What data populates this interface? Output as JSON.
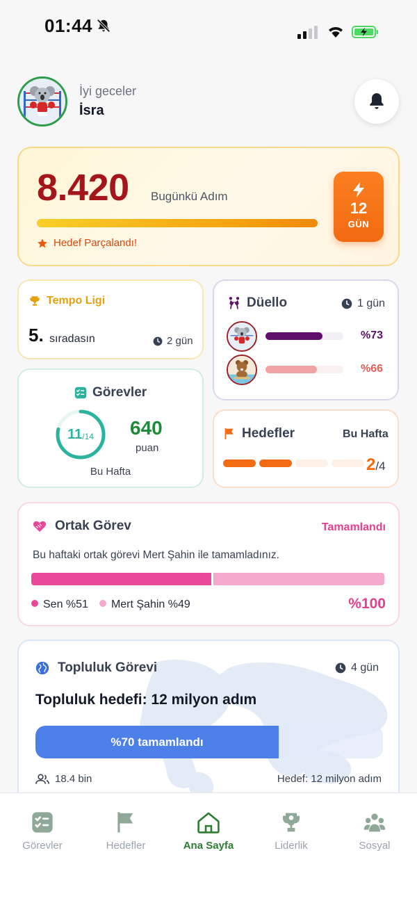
{
  "status_bar": {
    "time": "01:44"
  },
  "header": {
    "greeting": "İyi geceler",
    "user_name": "İsra"
  },
  "steps": {
    "value": "8.420",
    "label": "Bugünkü Adım",
    "progress": 1.0,
    "subtitle": "Hedef Parçalandı!",
    "streak_count": "12",
    "streak_unit": "GÜN"
  },
  "tempo": {
    "title": "Tempo Ligi",
    "rank": "5.",
    "rank_label": "sıradasın",
    "days": "2 gün"
  },
  "duel": {
    "title": "Düello",
    "days": "1 gün",
    "players": [
      {
        "percent_label": "%73",
        "progress": 0.73,
        "color": "#5e1168",
        "track": "#f1eef4"
      },
      {
        "percent_label": "%66",
        "progress": 0.66,
        "color": "#f0a3a3",
        "track": "#fbf0f0"
      }
    ]
  },
  "tasks": {
    "title": "Görevler",
    "done": "11",
    "total": "/14",
    "progress": 0.786,
    "points": "640",
    "points_label": "puan",
    "period": "Bu Hafta"
  },
  "goals": {
    "title": "Hedefler",
    "period": "Bu Hafta",
    "done": "2",
    "total": "/4",
    "completed": 2,
    "segments": 4
  },
  "shared_task": {
    "title": "Ortak Görev",
    "status": "Tamamlandı",
    "description": "Bu haftaki ortak görevi Mert Şahin ile tamamladınız.",
    "me_label": "Sen %51",
    "partner_label": "Mert Şahin %49",
    "me_share": 0.51,
    "total_label": "%100",
    "colors": {
      "me": "#e8489a",
      "partner": "#f4a9cd"
    }
  },
  "community": {
    "title": "Topluluk Görevi",
    "days": "4 gün",
    "goal": "Topluluk hedefi: 12 milyon adım",
    "progress": 0.7,
    "progress_label": "%70 tamamlandı",
    "members": "18.4 bin",
    "target": "Hedef: 12 milyon adım"
  },
  "nav": {
    "items": [
      {
        "label": "Görevler"
      },
      {
        "label": "Hedefler"
      },
      {
        "label": "Ana Sayfa"
      },
      {
        "label": "Liderlik"
      },
      {
        "label": "Sosyal"
      }
    ],
    "active": "Ana Sayfa"
  }
}
